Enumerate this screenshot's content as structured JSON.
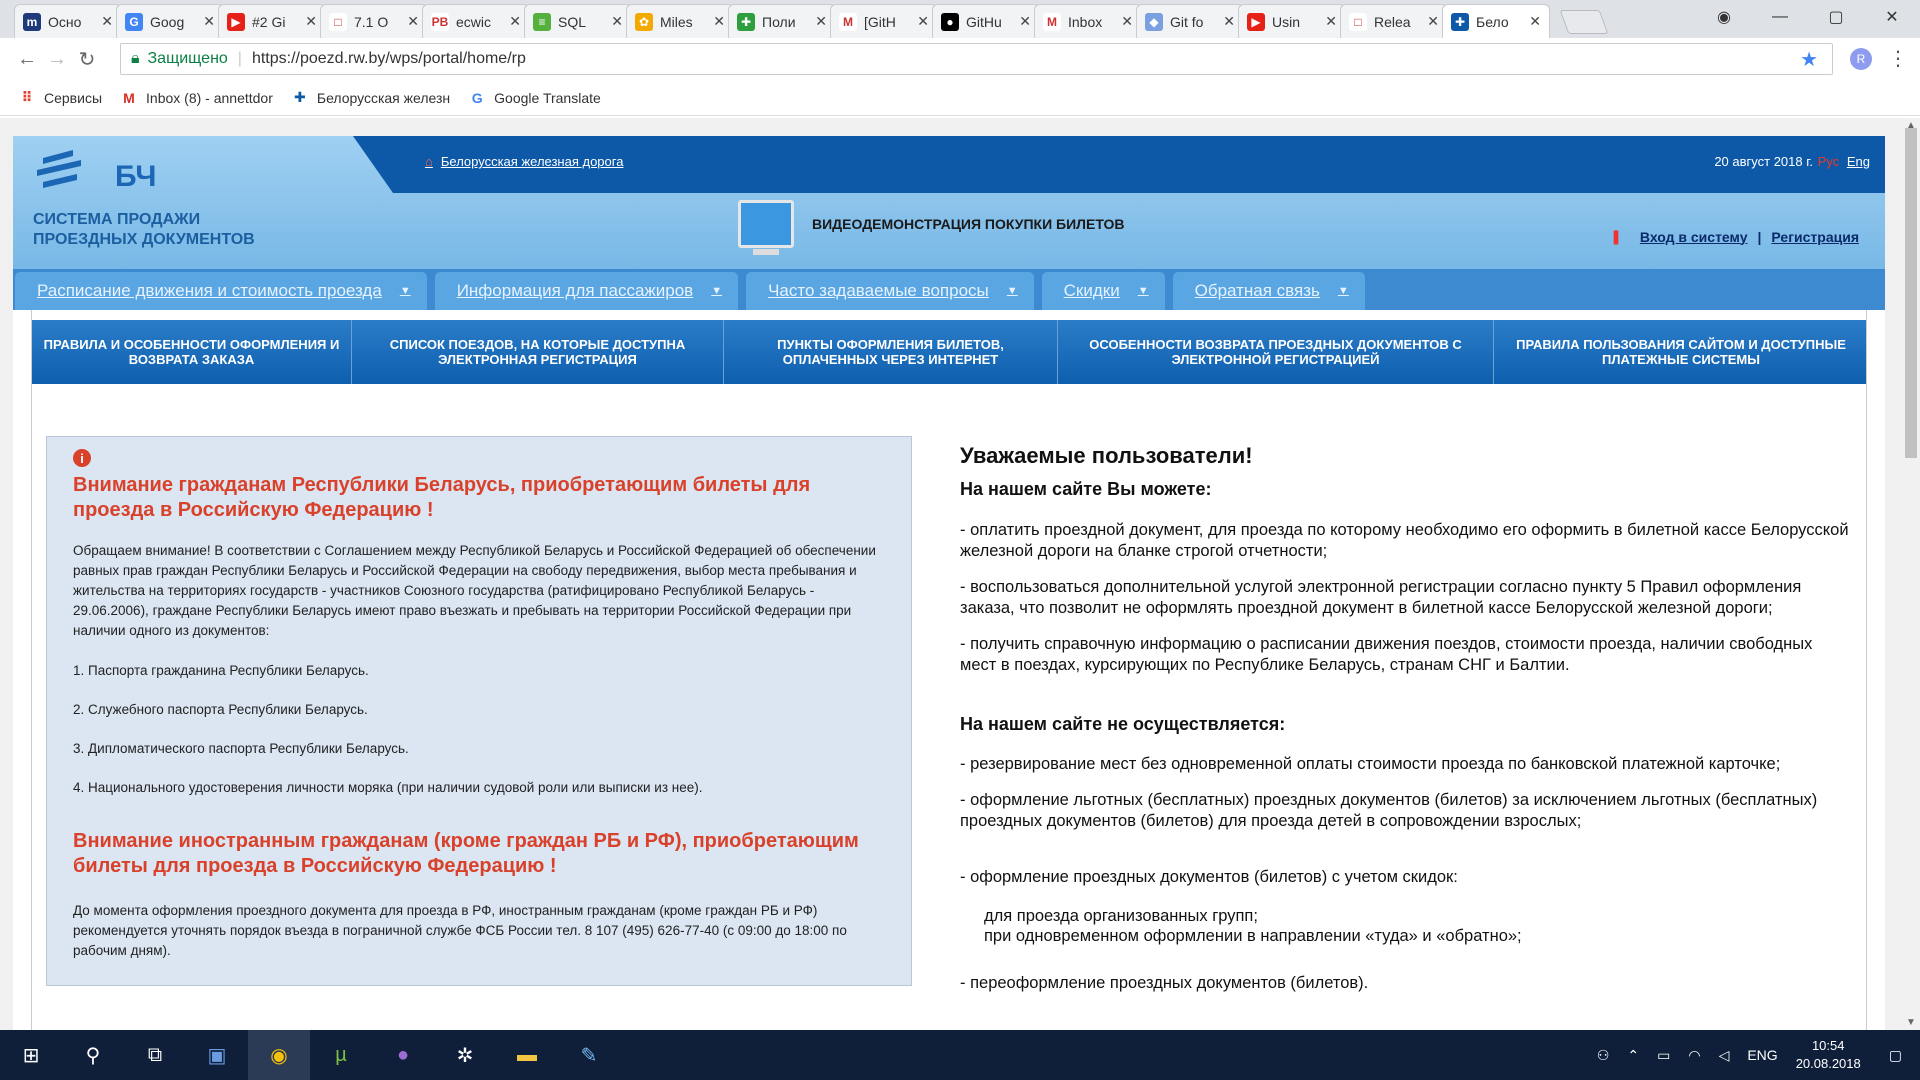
{
  "browser": {
    "tabs": [
      {
        "title": "Осно",
        "color": "#1e3a7b",
        "glyph": "m"
      },
      {
        "title": "Goog",
        "color": "#4285f4",
        "glyph": "G"
      },
      {
        "title": "#2 Gi",
        "color": "#e62117",
        "glyph": "▶"
      },
      {
        "title": "7.1 О",
        "color": "#ffffff",
        "glyph": "□"
      },
      {
        "title": "ecwic",
        "color": "#ffffff",
        "glyph": "PB"
      },
      {
        "title": "SQL",
        "color": "#56b03e",
        "glyph": "≡"
      },
      {
        "title": "Miles",
        "color": "#f2a900",
        "glyph": "✿"
      },
      {
        "title": "Поли",
        "color": "#2e9e3e",
        "glyph": "✚"
      },
      {
        "title": "[GitH",
        "color": "#ffffff",
        "glyph": "M"
      },
      {
        "title": "GitHu",
        "color": "#000000",
        "glyph": "●"
      },
      {
        "title": "Inbox",
        "color": "#ffffff",
        "glyph": "M"
      },
      {
        "title": "Git fo",
        "color": "#7aa0e0",
        "glyph": "◆"
      },
      {
        "title": "Usin",
        "color": "#e62117",
        "glyph": "▶"
      },
      {
        "title": "Relea",
        "color": "#ffffff",
        "glyph": "□"
      },
      {
        "title": "Бело",
        "color": "#0d59a8",
        "glyph": "✚"
      }
    ],
    "secure_label": "Защищено",
    "url": "https://poezd.rw.by/wps/portal/home/rp",
    "bookmarks": [
      {
        "label": "Сервисы"
      },
      {
        "label": "Inbox (8) - annettdor"
      },
      {
        "label": "Белорусская железн"
      },
      {
        "label": "Google Translate"
      }
    ]
  },
  "site": {
    "breadcrumb": "Белорусская железная дорога",
    "date": "20 август 2018 г.",
    "lang_ru": "Рус",
    "lang_en": "Eng",
    "logo_text_1": "СИСТЕМА ПРОДАЖИ",
    "logo_text_2": "ПРОЕЗДНЫХ ДОКУМЕНТОВ",
    "logo_mark": "БЧ",
    "video_label": "ВИДЕОДЕМОНСТРАЦИЯ ПОКУПКИ БИЛЕТОВ",
    "login_label": "Вход в систему",
    "register_label": "Регистрация",
    "main_nav": [
      {
        "label": "Расписание движения и стоимость проезда"
      },
      {
        "label": "Информация для пассажиров"
      },
      {
        "label": "Часто задаваемые вопросы"
      },
      {
        "label": "Скидки"
      },
      {
        "label": "Обратная связь"
      }
    ],
    "sub_nav": [
      {
        "label": "ПРАВИЛА И ОСОБЕННОСТИ ОФОРМЛЕНИЯ И ВОЗВРАТА ЗАКАЗА"
      },
      {
        "label": "СПИСОК ПОЕЗДОВ, НА КОТОРЫЕ ДОСТУПНА ЭЛЕКТРОННАЯ РЕГИСТРАЦИЯ"
      },
      {
        "label": "ПУНКТЫ ОФОРМЛЕНИЯ БИЛЕТОВ, ОПЛАЧЕННЫХ ЧЕРЕЗ ИНТЕРНЕТ"
      },
      {
        "label": "ОСОБЕННОСТИ ВОЗВРАТА ПРОЕЗДНЫХ ДОКУМЕНТОВ С ЭЛЕКТРОННОЙ РЕГИСТРАЦИЕЙ"
      },
      {
        "label": "ПРАВИЛА ПОЛЬЗОВАНИЯ САЙТОМ И ДОСТУПНЫЕ ПЛАТЕЖНЫЕ СИСТЕМЫ"
      }
    ],
    "alert": {
      "icon": "i",
      "heading1": "Внимание гражданам Республики Беларусь, приобретающим билеты для проезда в Российскую Федерацию !",
      "intro": "Обращаем внимание! В соответствии с Соглашением между Республикой Беларусь и Российской Федерацией об обеспечении равных прав граждан Республики Беларусь и Российской Федерации на свободу передвижения, выбор места пребывания и жительства на территориях государств - участников Союзного государства (ратифицировано Республикой Беларусь - 29.06.2006), граждане Республики Беларусь имеют право въезжать и пребывать на территории Российской Федерации при наличии одного из документов:",
      "items": [
        "1. Паспорта гражданина Республики Беларусь.",
        "2. Служебного паспорта Республики Беларусь.",
        "3. Дипломатического паспорта Республики Беларусь.",
        "4. Национального удостоверения личности моряка (при наличии судовой роли или выписки из нее)."
      ],
      "heading2": "Внимание иностранным гражданам (кроме граждан РБ и РФ), приобретающим билеты для проезда в Российскую Федерацию !",
      "note": "До момента оформления проездного документа для проезда в РФ, иностранным гражданам (кроме граждан РБ и РФ) рекомендуется уточнять порядок въезда в пограничной службе ФСБ России тел. 8 107 (495) 626-77-40 (с 09:00 до 18:00 по рабочим дням)."
    },
    "info": {
      "title": "Уважаемые пользователи!",
      "can_heading": "На нашем сайте Вы можете:",
      "can_items": [
        "- оплатить проездной документ, для проезда по которому необходимо его оформить в билетной кассе Белорусской железной дороги на бланке строгой отчетности;",
        "- воспользоваться дополнительной услугой электронной регистрации согласно пункту 5 Правил оформления заказа, что позволит не оформлять проездной документ в билетной кассе Белорусской железной дороги;",
        "- получить справочную информацию о расписании движения поездов, стоимости проезда, наличии свободных мест в поездах, курсирующих по Республике Беларусь, странам СНГ и Балтии."
      ],
      "cannot_heading": "На нашем сайте не осуществляется:",
      "cannot_items": [
        "- резервирование мест без одновременной оплаты стоимости проезда по банковской платежной карточке;",
        "- оформление льготных (бесплатных) проездных документов (билетов) за исключением льготных (бесплатных) проездных документов (билетов) для проезда детей в сопровождении взрослых;",
        "- оформление проездных документов (билетов) с учетом скидок:"
      ],
      "discount_items": [
        "для проезда организованных групп;",
        "при одновременном оформлении в направлении «туда» и «обратно»;"
      ],
      "last_item": "- переоформление проездных документов (билетов)."
    }
  },
  "taskbar": {
    "lang": "ENG",
    "time": "10:54",
    "date": "20.08.2018"
  }
}
